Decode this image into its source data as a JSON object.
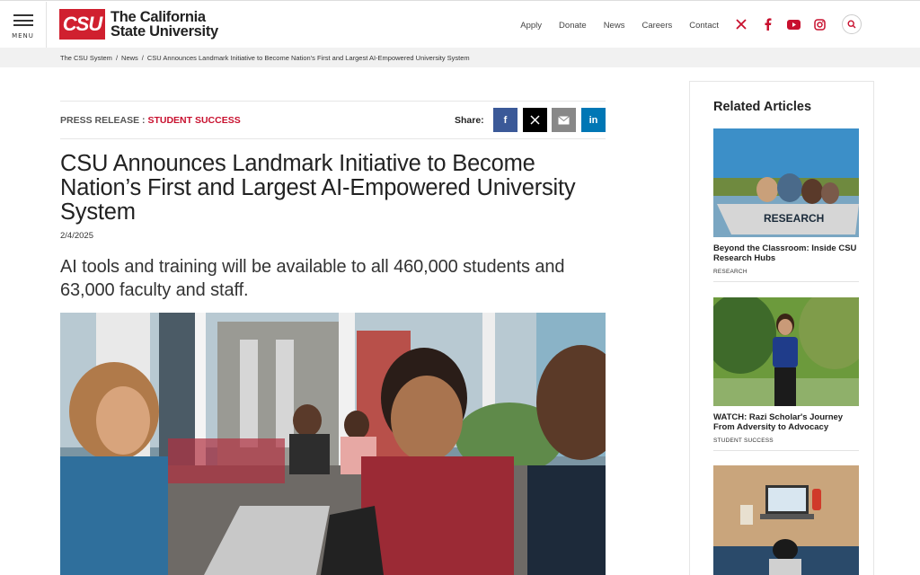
{
  "header": {
    "menu_label": "MENU",
    "logo_mark": "CSU",
    "logo_line1": "The California",
    "logo_line2": "State University",
    "nav": [
      "Apply",
      "Donate",
      "News",
      "Careers",
      "Contact"
    ],
    "social_icons": [
      "x-icon",
      "facebook-icon",
      "youtube-icon",
      "instagram-icon"
    ],
    "search_icon": "search-icon",
    "accent_color": "#c8102e"
  },
  "breadcrumb": {
    "items": [
      "The CSU System",
      "News",
      "CSU Announces Landmark Initiative to Become Nation’s First and Largest AI-Empowered University System"
    ]
  },
  "article": {
    "kicker_prefix": "PRESS RELEASE : ",
    "kicker_category": "STUDENT SUCCESS",
    "share_label": "Share:",
    "share_buttons": [
      "f",
      "𝕏",
      "✉",
      "in"
    ],
    "headline": "CSU Announces Landmark Initiative to Become Nation’s First and Largest AI-Empowered University System",
    "date": "2/4/2025",
    "subhead": "AI tools and training will be available to all 460,000 students and 63,000 faculty and staff."
  },
  "sidebar": {
    "title": "Related Articles",
    "cards": [
      {
        "title": "Beyond the Classroom: Inside CSU Research Hubs",
        "category": "RESEARCH",
        "boat_label": "RESEARCH"
      },
      {
        "title": "WATCH: Razi Scholar's Journey From Adversity to Advocacy",
        "category": "STUDENT SUCCESS"
      },
      {
        "title": "",
        "category": ""
      }
    ]
  }
}
